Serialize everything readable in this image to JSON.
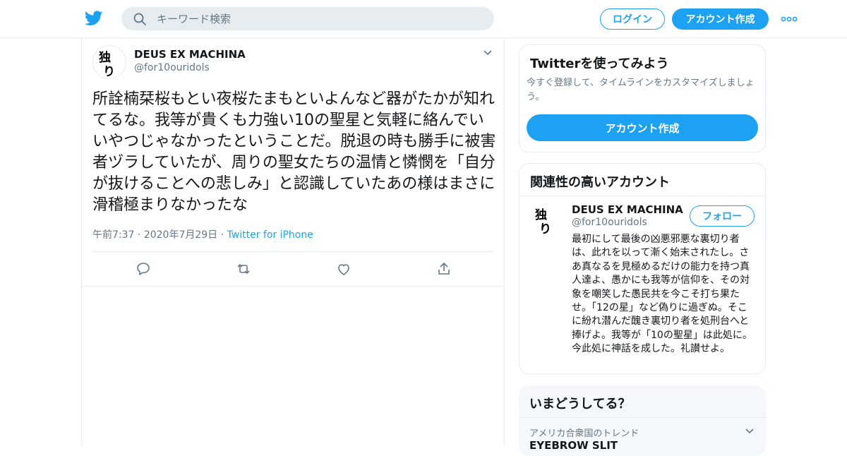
{
  "header": {
    "search_placeholder": "キーワード検索",
    "login_label": "ログイン",
    "signup_label": "アカウント作成",
    "accent": "#1da1f2"
  },
  "tweet": {
    "display_name": "DEUS EX MACHINA",
    "handle": "@for10ouridols",
    "avatar_text": "独り",
    "text": "所詮楠栞桜もとい夜桜たまもといよんなど器がたかが知れてるな。我等が貴くも力強い10の聖星と気軽に絡んでいいやつじゃなかったということだ。脱退の時も勝手に被害者ヅラしていたが、周りの聖女たちの温情と憐憫を「自分が抜けることへの悲しみ」と認識していたあの様はまさに滑稽極まりなかったな",
    "time": "午前7:37",
    "date": "2020年7月29日",
    "source": "Twitter for iPhone",
    "actions": [
      "reply-icon",
      "retweet-icon",
      "like-icon",
      "share-icon"
    ]
  },
  "signup_card": {
    "title": "Twitterを使ってみよう",
    "description": "今すぐ登録して、タイムラインをカスタマイズしましょう。",
    "button_label": "アカウント作成"
  },
  "related_card": {
    "title": "関連性の高いアカウント",
    "account": {
      "display_name": "DEUS EX MACHINA",
      "handle": "@for10ouridols",
      "follow_label": "フォロー",
      "bio": "最初にして最後の凶悪邪悪な裏切り者は、此れを以って漸く始末されたし。さあ真なるを見極めるだけの能力を持つ真人達よ、愚かにも我等が信仰を、その対象を嘲笑した愚民共を今こそ打ち果たせ。「12の星」など偽りに過ぎぬ。そこに紛れ潜んだ醜き裏切り者を処刑台へと捧げよ。我等が「10の聖星」は此処に。今此処に神話を成した。礼讃せよ。"
    }
  },
  "trends_card": {
    "title": "いまどうしてる？",
    "trend_location": "アメリカ合衆国のトレンド",
    "trend_topic": "EYEBROW SLIT"
  }
}
